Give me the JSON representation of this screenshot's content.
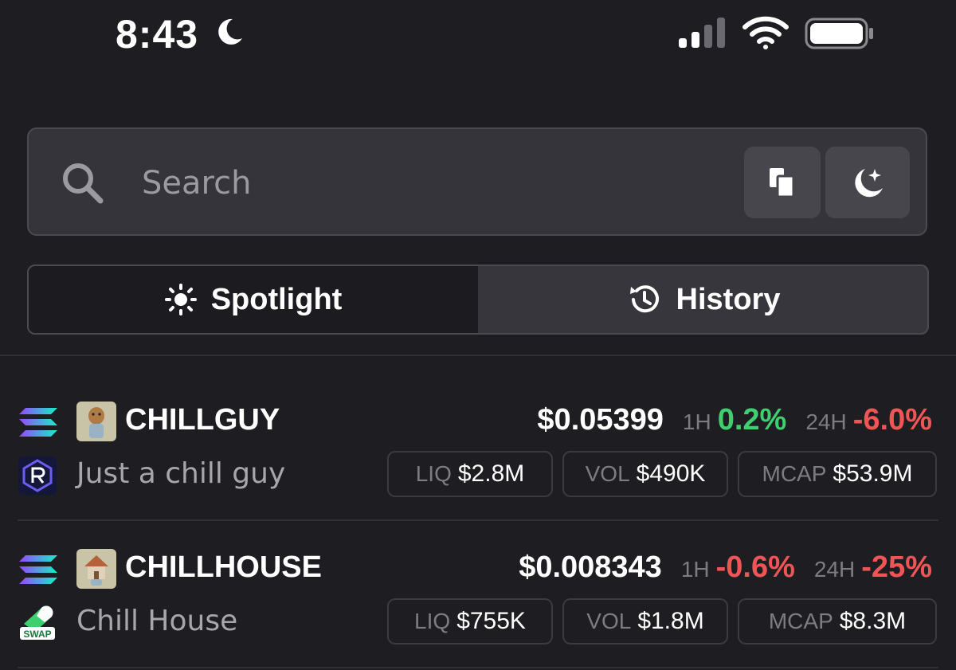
{
  "status_bar": {
    "time": "8:43",
    "icons": [
      "moon-icon",
      "cellular-signal-icon",
      "wifi-icon",
      "battery-icon"
    ]
  },
  "search": {
    "placeholder": "Search",
    "value": "",
    "buttons": [
      "paste-icon",
      "moon-sparkle-icon"
    ]
  },
  "tabs": [
    {
      "label": "Spotlight",
      "icon": "sun-icon",
      "active": true
    },
    {
      "label": "History",
      "icon": "history-clock-icon",
      "active": false
    }
  ],
  "tokens": [
    {
      "symbol": "CHILLGUY",
      "name": "Just a chill guy",
      "chain_icon": "solana-icon",
      "dex_icon": "raydium-icon",
      "price": "$0.05399",
      "h1_label": "1H",
      "h1_change": "0.2%",
      "h1_direction": "up",
      "h24_label": "24H",
      "h24_change": "-6.0%",
      "h24_direction": "down",
      "liq_label": "LIQ",
      "liq": "$2.8M",
      "vol_label": "VOL",
      "vol": "$490K",
      "mcap_label": "MCAP",
      "mcap": "$53.9M"
    },
    {
      "symbol": "CHILLHOUSE",
      "name": "Chill House",
      "chain_icon": "solana-icon",
      "dex_icon": "swap-pill-icon",
      "price": "$0.008343",
      "h1_label": "1H",
      "h1_change": "-0.6%",
      "h1_direction": "down",
      "h24_label": "24H",
      "h24_change": "-25%",
      "h24_direction": "down",
      "liq_label": "LIQ",
      "liq": "$755K",
      "vol_label": "VOL",
      "vol": "$1.8M",
      "mcap_label": "MCAP",
      "mcap": "$8.3M"
    }
  ],
  "colors": {
    "background": "#1e1e22",
    "positive": "#3fcf6e",
    "negative": "#f05555",
    "muted_text": "#7c7c82"
  }
}
